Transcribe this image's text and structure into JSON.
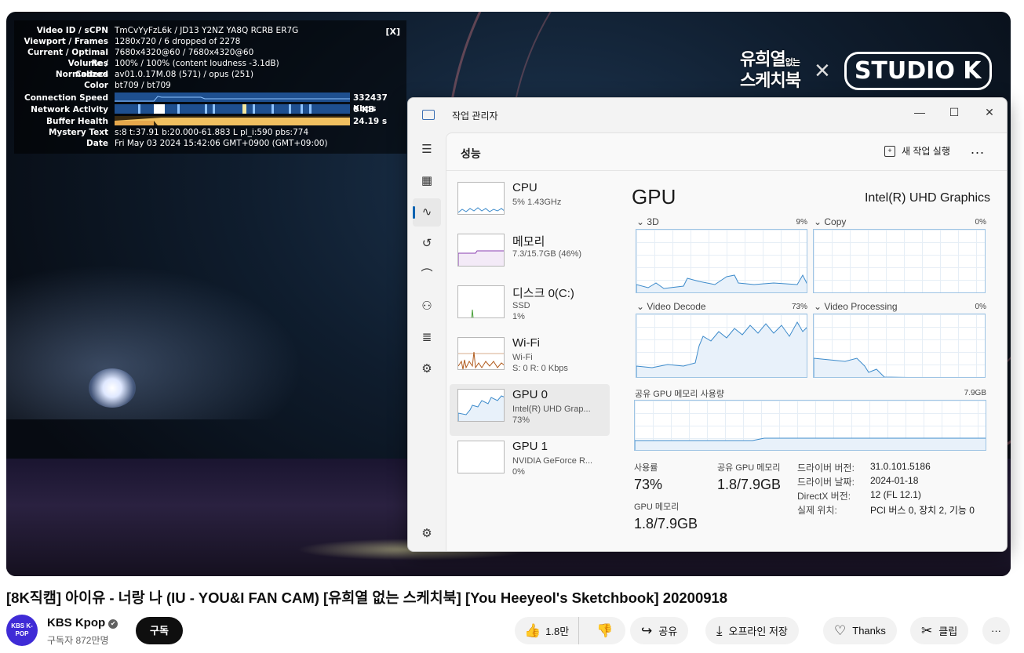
{
  "stats": {
    "close": "[X]",
    "rows": [
      {
        "k": "Video ID / sCPN",
        "v": "TmCvYyFzL6k  /  JD13 Y2NZ YA8Q RCRB ER7G"
      },
      {
        "k": "Viewport / Frames",
        "v": "1280x720 / 6 dropped of 2278"
      },
      {
        "k": "Current / Optimal Res",
        "v": "7680x4320@60 / 7680x4320@60"
      },
      {
        "k": "Volume / Normalized",
        "v": "100% / 100% (content loudness -3.1dB)"
      },
      {
        "k": "Codecs",
        "v": "av01.0.17M.08 (571) / opus (251)"
      },
      {
        "k": "Color",
        "v": "bt709 / bt709"
      },
      {
        "k": "Connection Speed",
        "v": "332437 Kbps"
      },
      {
        "k": "Network Activity",
        "v": "0 KB"
      },
      {
        "k": "Buffer Health",
        "v": "24.19 s"
      },
      {
        "k": "Mystery Text",
        "v": "s:8 t:37.91 b:20.000-61.883 L pl_i:590 pbs:774"
      },
      {
        "k": "Date",
        "v": "Fri May 03 2024 15:42:06 GMT+0900 (GMT+09:00)"
      }
    ]
  },
  "player_logo": {
    "line1": "유희열",
    "small": "없는",
    "line2": "스케치북",
    "x": "×",
    "studio": "STUDIO K"
  },
  "taskmgr": {
    "title": "작업 관리자",
    "page_title": "성능",
    "new_task": "새 작업 실행",
    "more": "...",
    "window_buttons": {
      "min": "—",
      "max": "☐",
      "close": "✕"
    },
    "nav_icons": [
      "menu-icon",
      "processes-icon",
      "performance-icon",
      "app-history-icon",
      "startup-icon",
      "users-icon",
      "details-icon",
      "services-icon",
      "settings-icon"
    ],
    "devices": [
      {
        "name": "CPU",
        "sub1": "5% 1.43GHz",
        "sub2": ""
      },
      {
        "name": "메모리",
        "sub1": "7.3/15.7GB (46%)",
        "sub2": ""
      },
      {
        "name": "디스크 0(C:)",
        "sub1": "SSD",
        "sub2": "1%"
      },
      {
        "name": "Wi-Fi",
        "sub1": "Wi-Fi",
        "sub2": "S: 0 R: 0 Kbps"
      },
      {
        "name": "GPU 0",
        "sub1": "Intel(R) UHD Grap...",
        "sub2": "73%"
      },
      {
        "name": "GPU 1",
        "sub1": "NVIDIA GeForce R...",
        "sub2": "0%"
      }
    ],
    "gpu_heading": "GPU",
    "gpu_name": "Intel(R) UHD Graphics",
    "engines": [
      {
        "label": "3D",
        "pct": "9%"
      },
      {
        "label": "Copy",
        "pct": "0%"
      },
      {
        "label": "Video Decode",
        "pct": "73%"
      },
      {
        "label": "Video Processing",
        "pct": "0%"
      }
    ],
    "shared_label": "공유 GPU 메모리 사용량",
    "shared_max": "7.9GB",
    "usage_label": "사용률",
    "usage_value": "73%",
    "shared_mem_label": "공유 GPU 메모리",
    "shared_mem_value": "1.8/7.9GB",
    "gpu_mem_label": "GPU 메모리",
    "gpu_mem_value": "1.8/7.9GB",
    "info": [
      {
        "k": "드라이버 버전:",
        "v": "31.0.101.5186"
      },
      {
        "k": "드라이버 날짜:",
        "v": "2024-01-18"
      },
      {
        "k": "DirectX 버전:",
        "v": "12 (FL 12.1)"
      },
      {
        "k": "실제 위치:",
        "v": "PCI 버스 0, 장치 2, 기능 0"
      }
    ]
  },
  "video_title": "[8K직캠] 아이유 - 너랑 나 (IU - YOU&I FAN CAM) [유희열 없는 스케치북] [You Heeyeol's Sketchbook] 20200918",
  "channel": {
    "avatar_text": "KBS K-POP",
    "name": "KBS Kpop",
    "verified": "✔",
    "subscribers": "구독자 872만명",
    "subscribe": "구독"
  },
  "actions": {
    "likes": "1.8만",
    "share": "공유",
    "offline": "오프라인 저장",
    "thanks": "Thanks",
    "clip": "클립",
    "more": "···"
  }
}
